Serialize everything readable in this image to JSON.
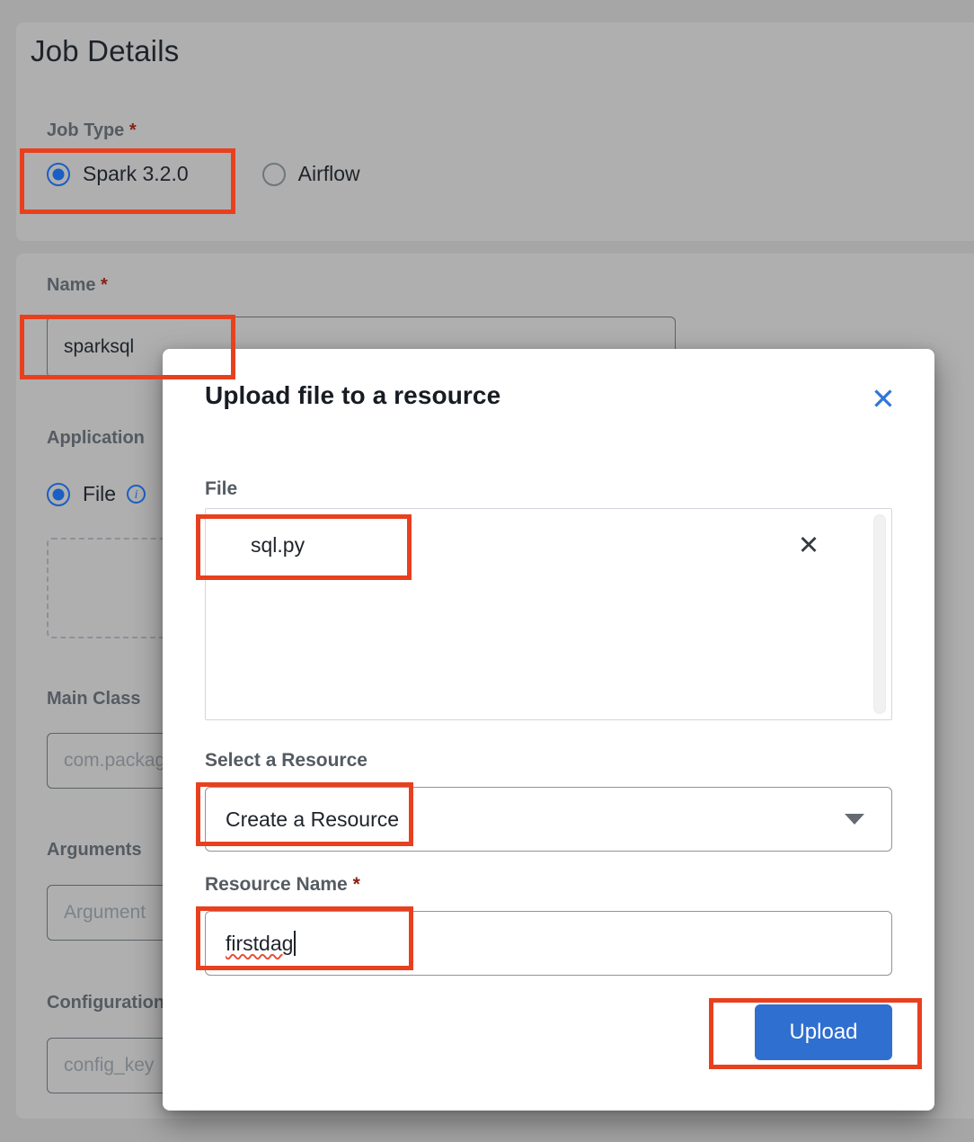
{
  "background": {
    "page_title": "Job Details",
    "job_type": {
      "label": "Job Type",
      "required_mark": "*",
      "options": [
        {
          "label": "Spark 3.2.0",
          "selected": true
        },
        {
          "label": "Airflow",
          "selected": false
        }
      ]
    },
    "name_field": {
      "label": "Name",
      "required_mark": "*",
      "value": "sparksql"
    },
    "application_field": {
      "label": "Application",
      "radio_label": "File",
      "info_icon": "info-icon"
    },
    "main_class_field": {
      "label": "Main Class",
      "placeholder": "com.package"
    },
    "arguments_field": {
      "label": "Arguments",
      "placeholder": "Argument"
    },
    "configuration_field": {
      "label": "Configuration",
      "placeholder": "config_key"
    }
  },
  "modal": {
    "title": "Upload file to a resource",
    "close_icon": "close-icon",
    "file_section": {
      "label": "File",
      "items": [
        {
          "name": "sql.py",
          "remove_icon": "close-icon"
        }
      ]
    },
    "select_resource": {
      "label": "Select a Resource",
      "value": "Create a Resource",
      "chevron_icon": "chevron-down-icon"
    },
    "resource_name": {
      "label": "Resource Name",
      "required_mark": "*",
      "value": "firstdag"
    },
    "upload_button": {
      "label": "Upload"
    }
  },
  "colors": {
    "accent_blue": "#2f6fd0",
    "highlight_red": "#e8401f",
    "required_star": "#8b2015",
    "backdrop_gray": "#a6a6a6"
  }
}
